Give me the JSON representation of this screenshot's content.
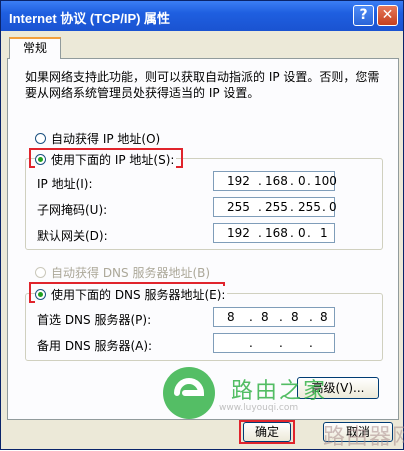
{
  "window": {
    "title": "Internet 协议 (TCP/IP) 属性",
    "help": "?",
    "close": "✕"
  },
  "tab": {
    "label": "常规"
  },
  "description": "如果网络支持此功能，则可以获取自动指派的 IP 设置。否则，您需要从网络系统管理员处获得适当的 IP 设置。",
  "ip_section": {
    "auto_label": "自动获得 IP 地址(O)",
    "manual_label": "使用下面的 IP 地址(S):",
    "fields": [
      {
        "label": "IP 地址(I):",
        "octets": [
          "192",
          "168",
          "0",
          "100"
        ]
      },
      {
        "label": "子网掩码(U):",
        "octets": [
          "255",
          "255",
          "255",
          "0"
        ]
      },
      {
        "label": "默认网关(D):",
        "octets": [
          "192",
          "168",
          "0",
          "1"
        ]
      }
    ]
  },
  "dns_section": {
    "auto_label": "自动获得 DNS 服务器地址(B)",
    "manual_label": "使用下面的 DNS 服务器地址(E):",
    "fields": [
      {
        "label": "首选 DNS 服务器(P):",
        "octets": [
          "8",
          "8",
          "8",
          "8"
        ]
      },
      {
        "label": "备用 DNS 服务器(A):",
        "octets": [
          "",
          "",
          "",
          ""
        ]
      }
    ]
  },
  "buttons": {
    "advanced": "高级(V)...",
    "ok": "确定",
    "cancel": "取消"
  },
  "watermark": {
    "text1": "路由之家",
    "text2": "www.luyouqi.com",
    "text3": "路由器网"
  },
  "colors": {
    "title_bar": "#1f5fe0",
    "highlight_red": "#e0242c",
    "radio_dot": "#21a121",
    "window_bg": "#ece9d8"
  }
}
